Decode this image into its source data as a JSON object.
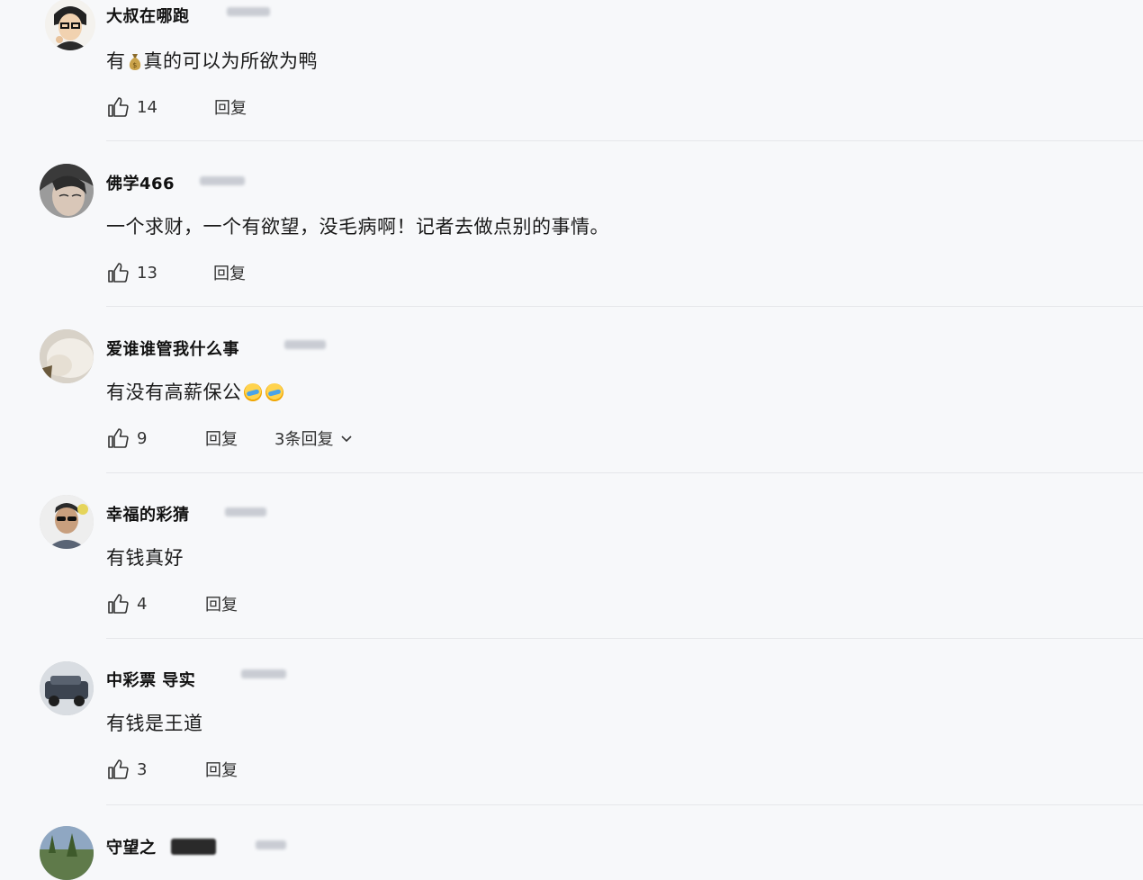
{
  "comments": [
    {
      "username": "大叔在哪跑",
      "text_before": "有",
      "text_emoji": "money-bag",
      "text_after": "真的可以为所欲为鸭",
      "likes": "14",
      "reply_label": "回复"
    },
    {
      "username": "佛学466",
      "text": "一个求财，一个有欲望，没毛病啊！记者去做点别的事情。",
      "likes": "13",
      "reply_label": "回复"
    },
    {
      "username": "爱谁谁管我什么事",
      "text": "有没有高薪保公",
      "text_emoji": "laughing-crying",
      "likes": "9",
      "reply_label": "回复",
      "more_replies": "3条回复"
    },
    {
      "username": "幸福的彩猜",
      "text": "有钱真好",
      "likes": "4",
      "reply_label": "回复"
    },
    {
      "username": "中彩票  导实",
      "text": "有钱是王道",
      "likes": "3",
      "reply_label": "回复"
    },
    {
      "username": "守望之"
    }
  ],
  "colors": {
    "background": "#f7f8fa",
    "divider": "#e6e7ea",
    "text": "#1a1a1a"
  }
}
